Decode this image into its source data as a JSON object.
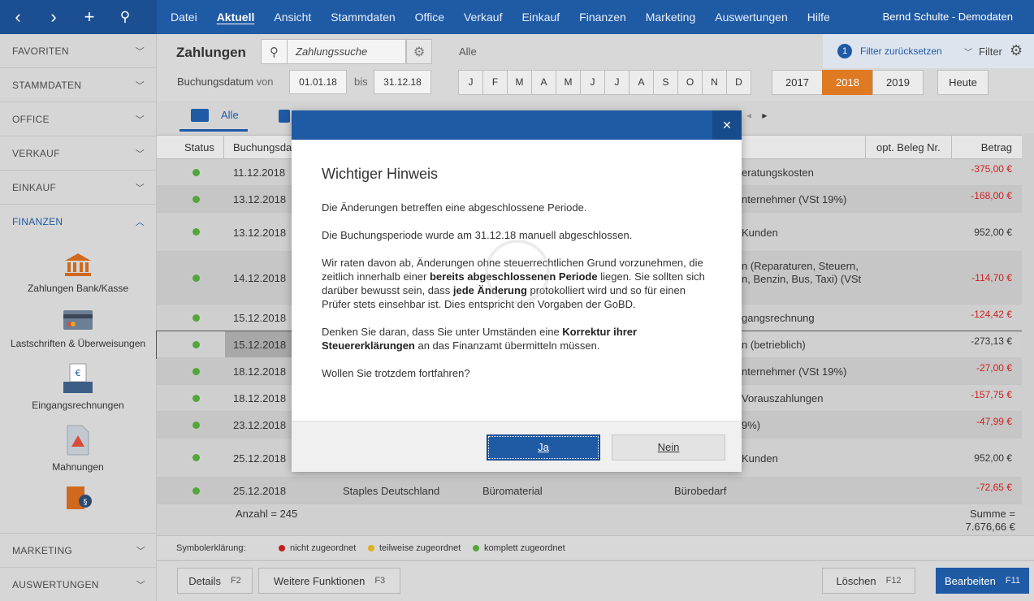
{
  "topbar": {
    "nav_icons": [
      "back-icon",
      "forward-icon",
      "plus-icon",
      "search-icon"
    ],
    "menu": [
      "Datei",
      "Aktuell",
      "Ansicht",
      "Stammdaten",
      "Office",
      "Verkauf",
      "Einkauf",
      "Finanzen",
      "Marketing",
      "Auswertungen",
      "Hilfe"
    ],
    "active_menu": "Aktuell",
    "user": "Bernd Schulte - Demodaten"
  },
  "sidebar": {
    "sections": [
      "FAVORITEN",
      "STAMMDATEN",
      "OFFICE",
      "VERKAUF",
      "EINKAUF",
      "FINANZEN"
    ],
    "open_section": "FINANZEN",
    "sub_items": [
      "Zahlungen Bank/Kasse",
      "Lastschriften & Überweisungen",
      "Eingangsrechnungen",
      "Mahnungen"
    ],
    "bottom_sections": [
      "MARKETING",
      "AUSWERTUNGEN"
    ]
  },
  "header": {
    "title": "Zahlungen",
    "search_placeholder": "Zahlungssuche",
    "filter_scope": "Alle",
    "filter_count": "1",
    "filter_reset": "Filter zurücksetzen",
    "filter_label": "Filter",
    "date_label": "Buchungsdatum",
    "von_label": "von",
    "date_from": "01.01.18",
    "bis_label": "bis",
    "date_to": "31.12.18",
    "months": [
      "J",
      "F",
      "M",
      "A",
      "M",
      "J",
      "J",
      "A",
      "S",
      "O",
      "N",
      "D"
    ],
    "years": [
      "2017",
      "2018",
      "2019"
    ],
    "selected_year": "2018",
    "today_label": "Heute"
  },
  "tabs": {
    "alle": "Alle"
  },
  "table": {
    "columns": {
      "status": "Status",
      "date": "Buchungsda",
      "beleg": "opt. Beleg Nr.",
      "betrag": "Betrag"
    },
    "rows": [
      {
        "date": "11.12.2018",
        "text": "eratungskosten",
        "amount": "-375,00 €"
      },
      {
        "date": "13.12.2018",
        "text": "nternehmer (VSt 19%)",
        "amount": "-168,00 €"
      },
      {
        "date": "13.12.2018",
        "text": "Kunden",
        "amount": "952,00 €"
      },
      {
        "date": "14.12.2018",
        "text": "n (Reparaturen, Steuern,\nn, Benzin, Bus, Taxi) (VSt",
        "amount": "-114,70 €"
      },
      {
        "date": "15.12.2018",
        "text": "gangsrechnung",
        "amount": "-124,42 €"
      },
      {
        "date": "15.12.2018",
        "text": "n (betrieblich)",
        "amount": "-273,13 €"
      },
      {
        "date": "18.12.2018",
        "text": "nternehmer (VSt 19%)",
        "amount": "-27,00 €"
      },
      {
        "date": "18.12.2018",
        "text": "Vorauszahlungen",
        "amount": "-157,75 €"
      },
      {
        "date": "23.12.2018",
        "text": "9%)",
        "amount": "-47,99 €"
      },
      {
        "date": "25.12.2018",
        "text": "Kunden",
        "amount": "952,00 €"
      },
      {
        "date": "25.12.2018",
        "partner": "Staples Deutschland",
        "category": "Büromaterial",
        "text": "Bürobedarf",
        "amount": "-72,65 €"
      }
    ],
    "count_label": "Anzahl = 245",
    "sum_label": "Summe =",
    "sum_value": "7.676,66 €"
  },
  "legend": {
    "title": "Symbolerklärung:",
    "items": [
      {
        "label": "nicht zugeordnet",
        "color": "#c0201f"
      },
      {
        "label": "teilweise zugeordnet",
        "color": "#e0b020"
      },
      {
        "label": "komplett zugeordnet",
        "color": "#52a63a"
      }
    ]
  },
  "buttons": {
    "details": "Details",
    "details_key": "F2",
    "more": "Weitere Funktionen",
    "more_key": "F3",
    "delete": "Löschen",
    "delete_key": "F12",
    "edit": "Bearbeiten",
    "edit_key": "F11"
  },
  "dialog": {
    "title": "Wichtiger Hinweis",
    "p1": "Die Änderungen betreffen eine abgeschlossene Periode.",
    "p2": "Die Buchungsperiode wurde am 31.12.18 manuell abgeschlossen.",
    "p3a": "Wir raten davon ab, Änderungen ohne steuerrechtlichen Grund vorzunehmen, die zeitlich innerhalb einer ",
    "p3b": "bereits abgeschlossenen Periode",
    "p3c": " liegen. Sie sollten sich darüber bewusst sein, dass ",
    "p3d": "jede Änderung",
    "p3e": " protokolliert wird und so für einen Prüfer stets einsehbar ist. Dies entspricht den Vorgaben der GoBD.",
    "p4a": "Denken Sie daran, dass Sie unter Umständen eine ",
    "p4b": "Korrektur ihrer Steuererklärungen",
    "p4c": " an das Finanzamt übermitteln müssen.",
    "p5": "Wollen Sie trotzdem fortfahren?",
    "yes": "Ja",
    "no": "Nein"
  }
}
